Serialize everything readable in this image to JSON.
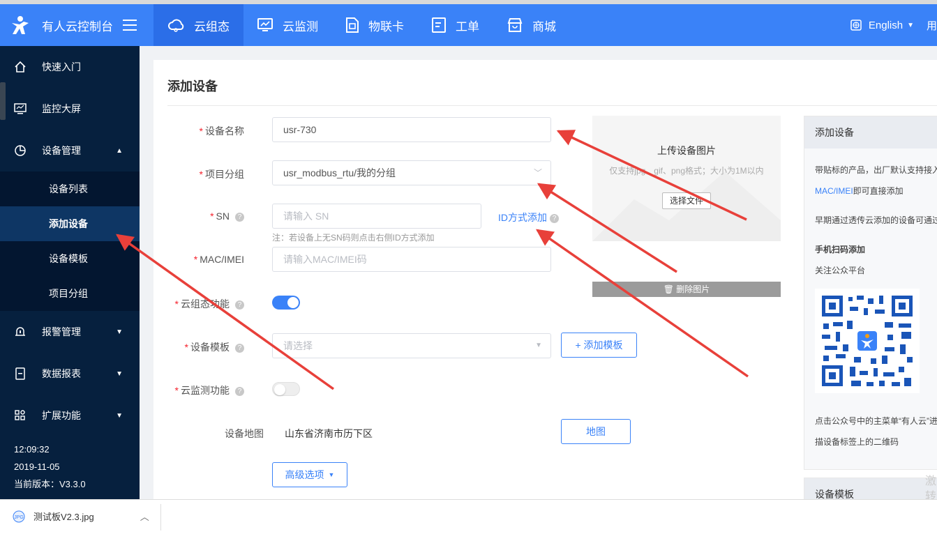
{
  "app": {
    "logo_text": "有人云控制台"
  },
  "topnav": {
    "items": [
      {
        "label": "云组态",
        "active": true
      },
      {
        "label": "云监测",
        "active": false
      },
      {
        "label": "物联卡",
        "active": false
      },
      {
        "label": "工单",
        "active": false
      },
      {
        "label": "商城",
        "active": false
      }
    ],
    "language": "English",
    "user_initial": "用"
  },
  "sidebar": {
    "items": [
      {
        "label": "快速入门",
        "icon": "home-icon"
      },
      {
        "label": "监控大屏",
        "icon": "monitor-icon"
      },
      {
        "label": "设备管理",
        "icon": "pie-icon",
        "expanded": true
      },
      {
        "label": "报警管理",
        "icon": "bell-icon"
      },
      {
        "label": "数据报表",
        "icon": "report-icon"
      },
      {
        "label": "扩展功能",
        "icon": "grid-icon"
      }
    ],
    "sub_items": [
      "设备列表",
      "添加设备",
      "设备模板",
      "项目分组"
    ],
    "active_sub": "添加设备",
    "time": "12:09:32",
    "date": "2019-11-05",
    "version": "当前版本：V3.3.0"
  },
  "form": {
    "title": "添加设备",
    "device_name_label": "设备名称",
    "device_name_value": "usr-730",
    "group_label": "项目分组",
    "group_value": "usr_modbus_rtu/我的分组",
    "sn_label": "SN",
    "sn_placeholder": "请输入 SN",
    "sn_link": "ID方式添加",
    "sn_hint": "注：若设备上无SN码则点击右侧ID方式添加",
    "mac_label": "MAC/IMEI",
    "mac_placeholder": "请输入MAC/IMEI码",
    "cloud_config_label": "云组态功能",
    "cloud_config_on": true,
    "template_label": "设备模板",
    "template_placeholder": "请选择",
    "add_template_button": "+ 添加模板",
    "cloud_monitor_label": "云监测功能",
    "cloud_monitor_on": false,
    "map_label": "设备地图",
    "map_value": "山东省济南市历下区",
    "map_button": "地图",
    "advanced_button": "高级选项"
  },
  "upload": {
    "title": "上传设备图片",
    "hint": "仅支持jpg、gif、png格式；大小为1M以内",
    "choose_button": "选择文件",
    "delete_button": "删除图片"
  },
  "help": {
    "title": "添加设备",
    "line1": "带贴标的产品，出厂默认支持接入",
    "line2_link": "MAC/IMEI",
    "line2_rest": "即可直接添加",
    "line3": "早期通过透传云添加的设备可通过",
    "scan_title": "手机扫码添加",
    "scan_line": "关注公众平台",
    "after_qr1": "点击公众号中的主菜单“有人云”进",
    "after_qr2": "描设备标签上的二维码",
    "panel2_title": "设备模板"
  },
  "download": {
    "filename": "测试板V2.3.jpg"
  },
  "watermark": {
    "line1": "激",
    "line2": "转"
  },
  "colors": {
    "primary": "#3a82f8",
    "sidebar_bg": "#06203e",
    "arrow": "#e8403a"
  }
}
